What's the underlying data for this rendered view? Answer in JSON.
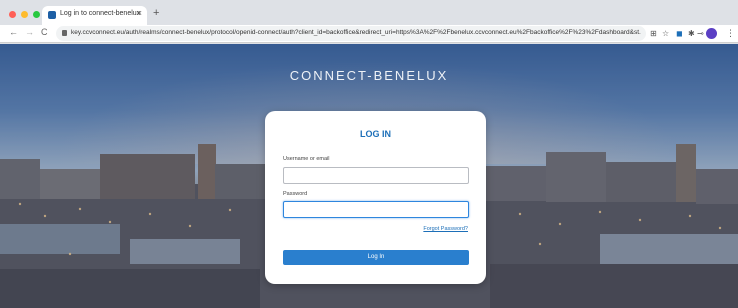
{
  "browser": {
    "tab_title": "Log in to connect-benelux",
    "tab_close": "×",
    "new_tab": "+",
    "url": "key.ccvconnect.eu/auth/realms/connect-benelux/protocol/openid-connect/auth?client_id=backoffice&redirect_uri=https%3A%2F%2Fbenelux.ccvconnect.eu%2Fbackoffice%2F%23%2Fdashboard&st...",
    "profile_initial": ""
  },
  "page": {
    "brand": "CONNECT-BENELUX"
  },
  "login": {
    "title": "LOG IN",
    "username_label": "Username or email",
    "username_value": "",
    "password_label": "Password",
    "password_value": "",
    "forgot_link": "Forgot Password?",
    "submit_label": "Log In"
  },
  "colors": {
    "accent": "#2a7fce",
    "title": "#1d6fb8"
  }
}
